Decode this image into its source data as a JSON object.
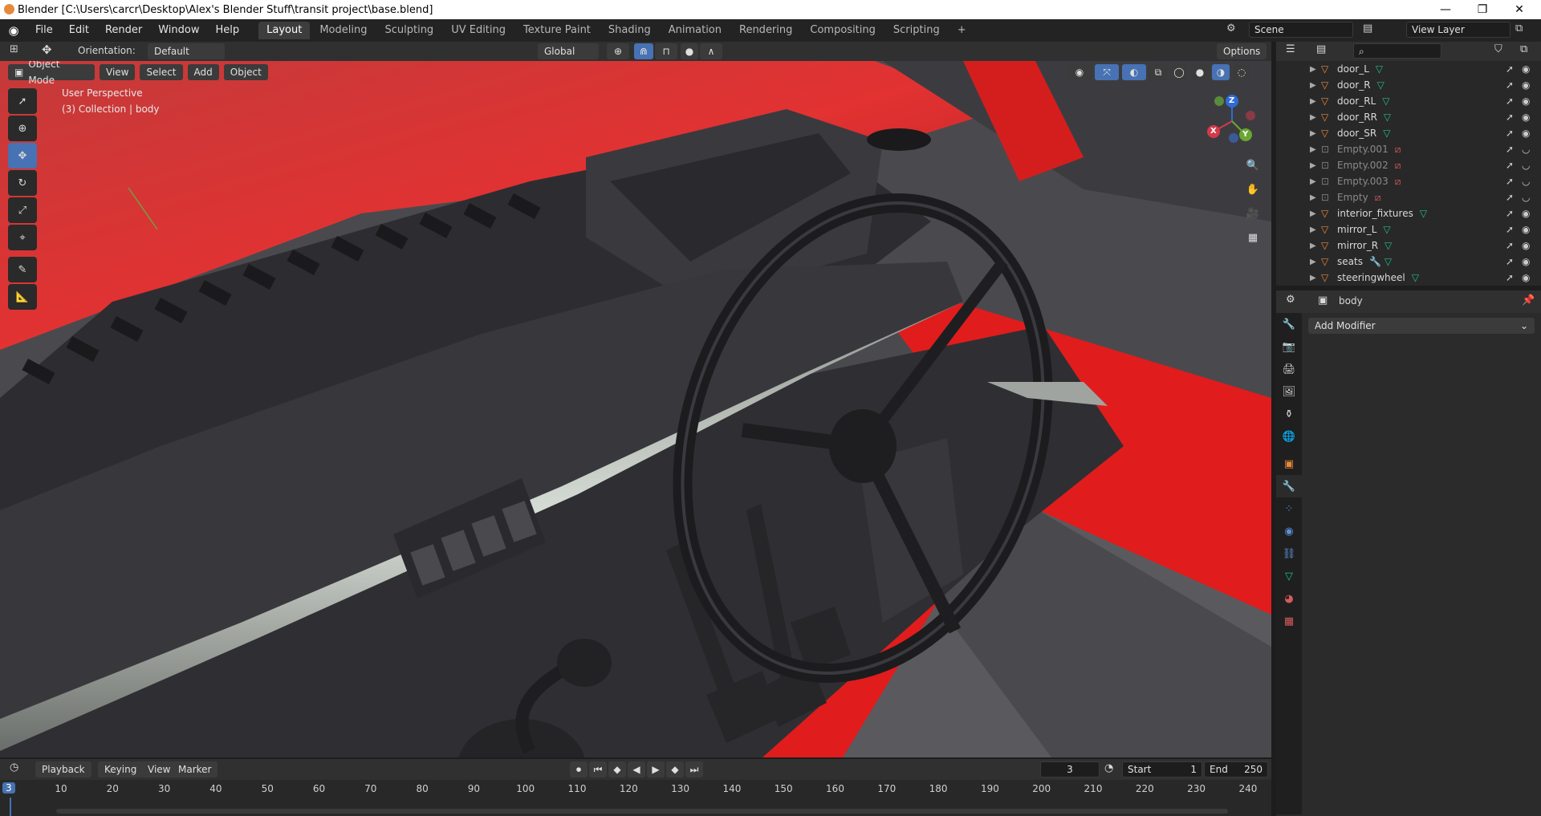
{
  "window": {
    "title": "Blender [C:\\Users\\carcr\\Desktop\\Alex's Blender Stuff\\transit project\\base.blend]",
    "minimize": "—",
    "maximize": "❐",
    "close": "✕"
  },
  "menu": [
    "File",
    "Edit",
    "Render",
    "Window",
    "Help"
  ],
  "workspaces": [
    "Layout",
    "Modeling",
    "Sculpting",
    "UV Editing",
    "Texture Paint",
    "Shading",
    "Animation",
    "Rendering",
    "Compositing",
    "Scripting"
  ],
  "workspace_add": "+",
  "scene": {
    "name": "Scene",
    "view_layer": "View Layer"
  },
  "tool_header": {
    "orientation_label": "Orientation:",
    "orientation_value": "Default",
    "transform_space": "Global",
    "options": "Options"
  },
  "viewport_header": {
    "mode": "Object Mode",
    "menus": [
      "View",
      "Select",
      "Add",
      "Object"
    ]
  },
  "viewport": {
    "perspective": "User Perspective",
    "collection_info": "(3) Collection | body"
  },
  "gizmo": {
    "x": "X",
    "y": "Y",
    "z": "Z"
  },
  "outliner": {
    "rows": [
      {
        "name": "door_L",
        "type": "mesh",
        "dim": false
      },
      {
        "name": "door_R",
        "type": "mesh",
        "dim": false
      },
      {
        "name": "door_RL",
        "type": "mesh",
        "dim": false
      },
      {
        "name": "door_RR",
        "type": "mesh",
        "dim": false
      },
      {
        "name": "door_SR",
        "type": "mesh",
        "dim": false
      },
      {
        "name": "Empty.001",
        "type": "empty",
        "dim": true
      },
      {
        "name": "Empty.002",
        "type": "empty",
        "dim": true
      },
      {
        "name": "Empty.003",
        "type": "empty",
        "dim": true
      },
      {
        "name": "Empty",
        "type": "empty",
        "dim": true
      },
      {
        "name": "interior_fixtures",
        "type": "mesh",
        "dim": false
      },
      {
        "name": "mirror_L",
        "type": "mesh",
        "dim": false
      },
      {
        "name": "mirror_R",
        "type": "mesh",
        "dim": false
      },
      {
        "name": "seats",
        "type": "mesh-mod",
        "dim": false
      },
      {
        "name": "steeringwheel",
        "type": "mesh",
        "dim": false
      }
    ]
  },
  "properties": {
    "object_name": "body",
    "add_modifier": "Add Modifier"
  },
  "timeline_header": {
    "menus": [
      "Playback",
      "Keying",
      "View",
      "Marker"
    ],
    "current_frame": "3",
    "start_label": "Start",
    "start_value": "1",
    "end_label": "End",
    "end_value": "250"
  },
  "timeline": {
    "current": "3",
    "ticks": [
      "10",
      "20",
      "30",
      "40",
      "50",
      "60",
      "70",
      "80",
      "90",
      "100",
      "110",
      "120",
      "130",
      "140",
      "150",
      "160",
      "170",
      "180",
      "190",
      "200",
      "210",
      "220",
      "230",
      "240"
    ]
  },
  "colors": {
    "accent": "#4772b3",
    "mesh": "#1fbf8f",
    "object": "#e8893a",
    "car_red": "#d62020"
  }
}
